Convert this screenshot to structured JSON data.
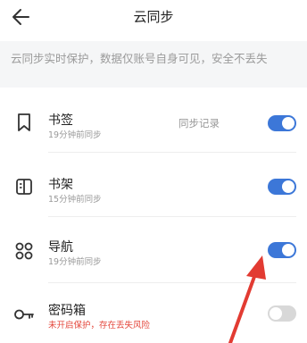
{
  "header": {
    "title": "云同步",
    "back_icon": "arrow-left-icon"
  },
  "notice": {
    "text": "云同步实时保护，数据仅账号自身可见，安全不丢失"
  },
  "items": [
    {
      "label": "书签",
      "sub": "19分钟前同步",
      "icon": "bookmark-icon",
      "extra": "同步记录",
      "enabled": true
    },
    {
      "label": "书架",
      "sub": "15分钟前同步",
      "icon": "bookshelf-icon",
      "enabled": true
    },
    {
      "label": "导航",
      "sub": "19分钟前同步",
      "icon": "grid-icon",
      "enabled": true
    },
    {
      "label": "密码箱",
      "sub": "未开启保护，存在丢失风险",
      "icon": "key-icon",
      "enabled": false,
      "sub_color": "#e4473c"
    }
  ],
  "colors": {
    "toggle_on": "#3c77d8",
    "toggle_off": "#d8d8d8",
    "annotation_arrow": "#e23b32"
  }
}
